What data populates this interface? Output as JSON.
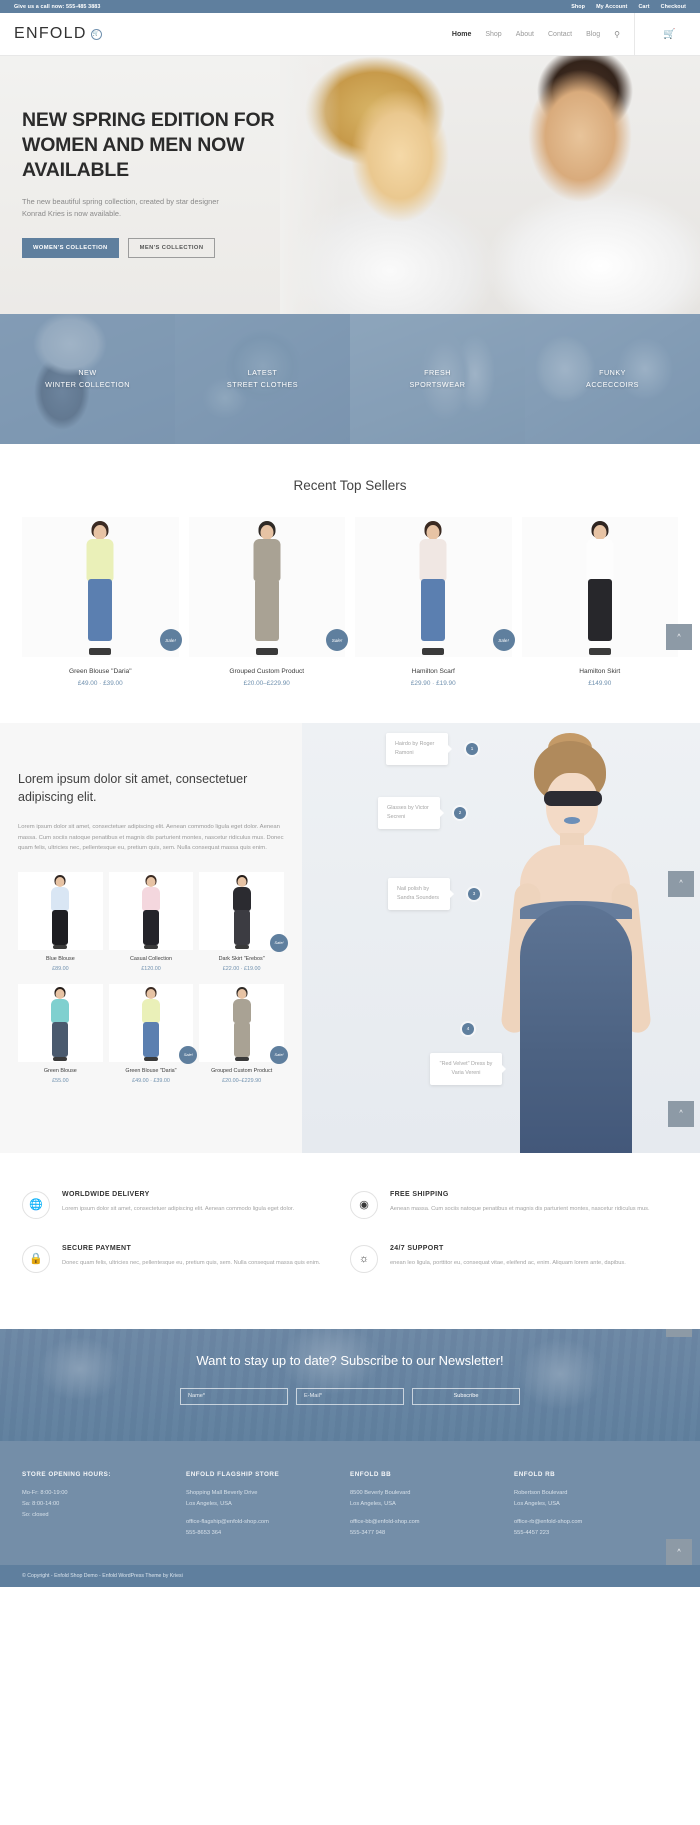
{
  "topbar": {
    "phone": "Give us a call now: 555-485 3883",
    "links": [
      "Shop",
      "My Account",
      "Cart",
      "Checkout"
    ]
  },
  "header": {
    "logo": "ENFOLD",
    "logo_badge_icon": "cart-badge-icon",
    "nav": [
      {
        "label": "Home",
        "active": true
      },
      {
        "label": "Shop",
        "active": false
      },
      {
        "label": "About",
        "active": false
      },
      {
        "label": "Contact",
        "active": false
      },
      {
        "label": "Blog",
        "active": false
      }
    ],
    "search_icon": "search-icon",
    "cart_icon": "shopping-cart-icon"
  },
  "hero": {
    "heading": "NEW SPRING EDITION FOR WOMEN AND MEN NOW AVAILABLE",
    "subtext": "The new beautiful spring collection, created by star designer Konrad Kries is now available.",
    "primary_button": "WOMEN'S COLLECTION",
    "secondary_button": "MEN'S COLLECTION"
  },
  "categories": [
    {
      "line1": "NEW",
      "line2": "WINTER COLLECTION"
    },
    {
      "line1": "LATEST",
      "line2": "STREET CLOTHES"
    },
    {
      "line1": "FRESH",
      "line2": "SPORTSWEAR"
    },
    {
      "line1": "FUNKY",
      "line2": "ACCECCOIRS"
    }
  ],
  "sellers": {
    "title": "Recent Top Sellers",
    "sale_label": "Sale!",
    "items": [
      {
        "name": "Green Blouse \"Daria\"",
        "price": "£49.00 · £39.00",
        "sale": true,
        "hair": "#3a2a22",
        "top": "#eaf0b8",
        "bottom": "#5b7fb0"
      },
      {
        "name": "Grouped Custom Product",
        "price": "£20.00–£229.90",
        "sale": true,
        "hair": "#2f2a26",
        "top": "#a9a294",
        "bottom": "#a9a294"
      },
      {
        "name": "Hamilton Scarf",
        "price": "£29.90 · £19.90",
        "sale": true,
        "hair": "#3a2a22",
        "top": "#f0e7e3",
        "bottom": "#5b7fb0"
      },
      {
        "name": "Hamilton Skirt",
        "price": "£149.90",
        "sale": false,
        "hair": "#2e2420",
        "top": "#fdfdfd",
        "bottom": "#27272b"
      }
    ]
  },
  "split": {
    "heading": "Lorem ipsum dolor sit amet, consectetuer adipiscing elit.",
    "body": "Lorem ipsum dolor sit amet, consectetuer adipiscing elit. Aenean commodo ligula eget dolor. Aenean massa. Cum sociis natoque penatibus et magnis dis parturient montes, nascetur ridiculus mus. Donec quam felis, ultricies nec, pellentesque eu, pretium quis, sem. Nulla consequat massa quis enim.",
    "sale_label": "Sale!",
    "products": [
      {
        "name": "Blue Blouse",
        "price": "£89.00",
        "sale": false,
        "hair": "#2e2420",
        "top": "#d9e6f4",
        "bottom": "#1e1e22"
      },
      {
        "name": "Casual Collection",
        "price": "£120.00",
        "sale": false,
        "hair": "#3a2a22",
        "top": "#f4d7de",
        "bottom": "#24242a"
      },
      {
        "name": "Dark Skirt \"Erebos\"",
        "price": "£22.00 · £19.00",
        "sale": true,
        "hair": "#241c18",
        "top": "#2b2b30",
        "bottom": "#3c3c42"
      },
      {
        "name": "Green Blouse",
        "price": "£55.00",
        "sale": false,
        "hair": "#241c18",
        "top": "#7fd0cf",
        "bottom": "#4a5a6e"
      },
      {
        "name": "Green Blouse \"Daria\"",
        "price": "£49.00 · £39.00",
        "sale": true,
        "hair": "#3a2a22",
        "top": "#eaf0b8",
        "bottom": "#5b7fb0"
      },
      {
        "name": "Grouped Custom Product",
        "price": "£20.00–£229.90",
        "sale": true,
        "hair": "#2f2a26",
        "top": "#a9a294",
        "bottom": "#a9a294"
      }
    ],
    "hotspots": [
      {
        "number": "1",
        "text": "Hairdo by Roger Ramoni"
      },
      {
        "number": "2",
        "text": "Glasses by Victor Secreni"
      },
      {
        "number": "3",
        "text": "Nail polish by Sandra Sounders"
      },
      {
        "number": "4",
        "text": "\"Red Velvet\" Dress by Varia Vereni"
      }
    ]
  },
  "features": [
    {
      "icon": "globe-icon",
      "title": "WORLDWIDE DELIVERY",
      "text": "Lorem ipsum dolor sit amet, consectetuer adipiscing elit. Aenean commodo ligula eget dolor."
    },
    {
      "icon": "shipping-icon",
      "title": "FREE SHIPPING",
      "text": "Aenean massa. Cum sociis natoque penatibus et magnis dis parturient montes, nascetur ridiculus mus."
    },
    {
      "icon": "lock-icon",
      "title": "SECURE PAYMENT",
      "text": "Donec quam felis, ultricies nec, pellentesque eu, pretium quis, sem. Nulla consequat massa quis enim."
    },
    {
      "icon": "lifebuoy-icon",
      "title": "24/7 SUPPORT",
      "text": "enean leo ligula, porttitor eu, consequat vitae, eleifend ac, enim. Aliquam lorem ante, dapibus."
    }
  ],
  "newsletter": {
    "heading": "Want to stay up to date? Subscribe to our Newsletter!",
    "name_placeholder": "Name*",
    "email_placeholder": "E-Mail*",
    "submit_label": "Subscribe"
  },
  "footer": {
    "columns": [
      {
        "title": "STORE OPENING HOURS:",
        "lines": [
          "Mo-Fr: 8:00-19:00",
          "Sa: 8:00-14:00",
          "So: closed"
        ],
        "extra": []
      },
      {
        "title": "ENFOLD FLAGSHIP STORE",
        "lines": [
          "Shopping Mall Beverly Drive",
          "Los Angeles, USA"
        ],
        "extra": [
          "office-flagship@enfold-shop.com",
          "555-8653 364"
        ]
      },
      {
        "title": "ENFOLD BB",
        "lines": [
          "8500 Beverly Boulevard",
          "Los Angeles, USA"
        ],
        "extra": [
          "office-bb@enfold-shop.com",
          "555-3477 948"
        ]
      },
      {
        "title": "ENFOLD RB",
        "lines": [
          "Robertson Boulevard",
          "Los Angeles, USA"
        ],
        "extra": [
          "office-rb@enfold-shop.com",
          "555-4457 223"
        ]
      }
    ]
  },
  "copyright": "© Copyright - Enfold Shop Demo - Enfold WordPress Theme by Kriesi",
  "scroll_top_icon": "chevron-up-icon",
  "colors": {
    "accent": "#5f7f9e",
    "footer": "#748ea8",
    "price": "#6f90ae"
  }
}
